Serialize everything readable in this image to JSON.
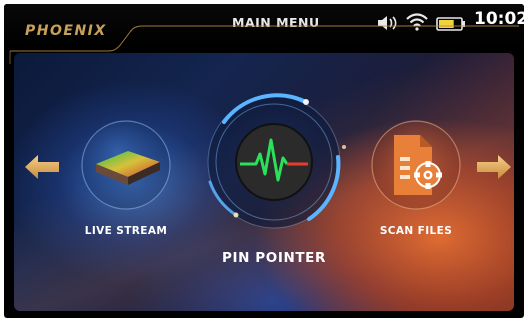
{
  "header": {
    "brand": "PHOENIX",
    "title": "MAIN MENU",
    "time": "10:02",
    "icons": [
      "speaker-icon",
      "wifi-icon",
      "battery-icon"
    ],
    "battery_level": 0.7
  },
  "carousel": {
    "prev_icon": "arrow-left-icon",
    "next_icon": "arrow-right-icon",
    "items": [
      {
        "label": "LIVE STREAM",
        "icon": "stream-plate-icon",
        "selected": false
      },
      {
        "label": "PIN POINTER",
        "icon": "heartbeat-signal-icon",
        "selected": true
      },
      {
        "label": "SCAN FILES",
        "icon": "document-gear-icon",
        "selected": false
      }
    ]
  },
  "colors": {
    "brand_gold": "#c8a25a",
    "arrow_gold": "#e8b567",
    "ring_blue": "#5ab4ff",
    "signal_green": "#2be05a",
    "signal_red": "#e83a2e",
    "file_orange": "#e8803a"
  }
}
